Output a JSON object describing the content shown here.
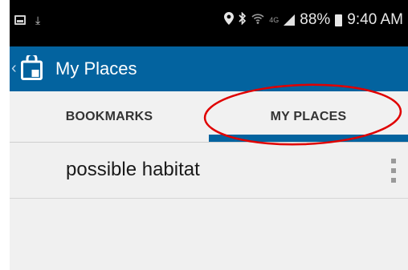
{
  "status_bar": {
    "lte": "4G",
    "battery": "88%",
    "time": "9:40 AM"
  },
  "app_bar": {
    "title": "My Places"
  },
  "tabs": [
    {
      "label": "BOOKMARKS",
      "selected": false
    },
    {
      "label": "MY PLACES",
      "selected": true
    }
  ],
  "places": [
    {
      "name": "possible habitat"
    }
  ],
  "colors": {
    "primary": "#03639f",
    "annotation": "#e00000"
  },
  "icons": [
    "image-icon",
    "download-icon",
    "location-icon",
    "bluetooth-icon",
    "wifi-icon",
    "signal-icon",
    "battery-icon",
    "back-chevron-icon",
    "map-bookmark-icon",
    "overflow-menu-icon"
  ]
}
